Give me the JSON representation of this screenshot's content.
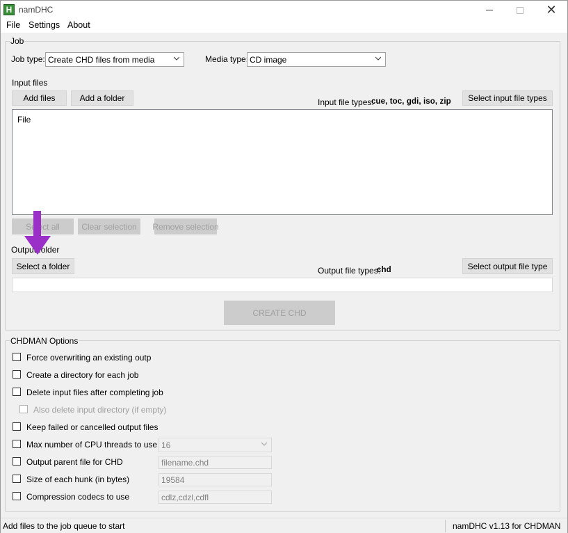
{
  "window": {
    "title": "namDHC",
    "app_icon_letter": "H"
  },
  "menu": [
    "File",
    "Settings",
    "About"
  ],
  "job": {
    "group_label": "Job",
    "job_type_label": "Job type:",
    "job_type_value": "Create CHD files from media",
    "media_type_label": "Media type:",
    "media_type_value": "CD image",
    "input_files_label": "Input files",
    "add_files": "Add files",
    "add_folder": "Add a folder",
    "input_types_label": "Input file types:",
    "input_types_value": "cue, toc, gdi, iso, zip",
    "select_input_types": "Select input file types",
    "list_header": "File",
    "select_all": "Select all",
    "clear_selection": "Clear selection",
    "remove_selection": "Remove selection",
    "output_folder_label": "Output folder",
    "select_folder": "Select a folder",
    "output_types_label": "Output file types:",
    "output_types_value": "chd",
    "select_output_type": "Select output file type",
    "output_path": "",
    "create_button": "CREATE CHD"
  },
  "chdman": {
    "group_label": "CHDMAN Options",
    "options": [
      {
        "label": "Force overwriting an existing output file",
        "checked": false,
        "enabled": true
      },
      {
        "label": "Create a directory for each job",
        "checked": false,
        "enabled": true
      },
      {
        "label": "Delete input files after completing job",
        "checked": false,
        "enabled": true
      },
      {
        "label": "Also delete input directory (if empty)",
        "checked": false,
        "enabled": false
      },
      {
        "label": "Keep failed or cancelled output files",
        "checked": false,
        "enabled": true
      },
      {
        "label": "Max number of CPU threads to use",
        "checked": false,
        "enabled": true
      },
      {
        "label": "Output parent file for CHD",
        "checked": false,
        "enabled": true
      },
      {
        "label": "Size of each hunk (in bytes)",
        "checked": false,
        "enabled": true
      },
      {
        "label": "Compression codecs to use",
        "checked": false,
        "enabled": true
      }
    ],
    "cpu_threads_value": "16",
    "parent_file_value": "filename.chd",
    "hunk_size_value": "19584",
    "codecs_value": "cdlz,cdzl,cdfl"
  },
  "status": {
    "left": "Add files to the job queue to start",
    "right": "namDHC v1.13 for CHDMAN"
  },
  "colors": {
    "arrow": "#9b30c8",
    "app_icon": "#3a8f3a"
  }
}
